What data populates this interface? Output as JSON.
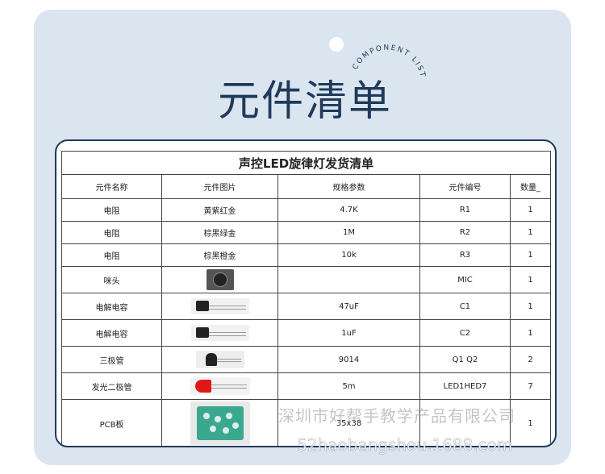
{
  "header": {
    "title": "元件清单",
    "arc_label": "COMPONENT LIST"
  },
  "table": {
    "sheet_title": "声控LED旋律灯发货清单",
    "columns": [
      "元件名称",
      "元件图片",
      "规格参数",
      "元件编号",
      "数量_"
    ],
    "rows": [
      {
        "name": "电阻",
        "image_text": "黄紫红金",
        "spec": "4.7K",
        "code": "R1",
        "qty": "1",
        "image": ""
      },
      {
        "name": "电阻",
        "image_text": "棕黑绿金",
        "spec": "1M",
        "code": "R2",
        "qty": "1",
        "image": ""
      },
      {
        "name": "电阻",
        "image_text": "棕黑橙金",
        "spec": "10k",
        "code": "R3",
        "qty": "1",
        "image": ""
      },
      {
        "name": "咪头",
        "image_text": "",
        "spec": "",
        "code": "MIC",
        "qty": "1",
        "image": "microphone-photo"
      },
      {
        "name": "电解电容",
        "image_text": "",
        "spec": "47uF",
        "code": "C1",
        "qty": "1",
        "image": "capacitor-photo"
      },
      {
        "name": "电解电容",
        "image_text": "",
        "spec": "1uF",
        "code": "C2",
        "qty": "1",
        "image": "capacitor-photo"
      },
      {
        "name": "三极管",
        "image_text": "",
        "spec": "9014",
        "code": "Q1 Q2",
        "qty": "2",
        "image": "transistor-photo"
      },
      {
        "name": "发光二极管",
        "image_text": "",
        "spec": "5m",
        "code": "LED1HED7",
        "qty": "7",
        "image": "led-photo"
      },
      {
        "name": "PCB板",
        "image_text": "",
        "spec": "35x38",
        "code": "",
        "qty": "1",
        "image": "pcb-photo"
      }
    ]
  },
  "watermark": {
    "line1": "深圳市好帮手教学产品有限公司",
    "line2": "52haobangshou.1688.com"
  }
}
